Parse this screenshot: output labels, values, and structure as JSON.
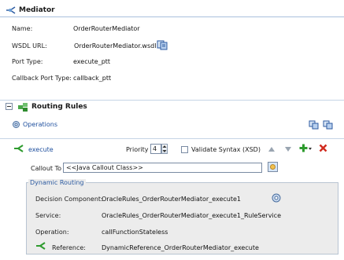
{
  "header": {
    "title": "Mediator"
  },
  "properties": [
    {
      "label": "Name:",
      "value": "OrderRouterMediator"
    },
    {
      "label": "WSDL URL:",
      "value": "OrderRouterMediator.wsdl"
    },
    {
      "label": "Port Type:",
      "value": "execute_ptt"
    },
    {
      "label": "Callback Port Type:",
      "value": "callback_ptt"
    }
  ],
  "routing": {
    "section_title": "Routing Rules",
    "operations_label": "Operations",
    "operation_name": "execute",
    "priority_label": "Priority",
    "priority_value": "4",
    "validate_label": "Validate Syntax (XSD)",
    "callout_label": "Callout To",
    "callout_value": "<<Java Callout Class>>"
  },
  "dynamic_routing": {
    "legend": "Dynamic Routing",
    "rows": [
      {
        "label": "Decision Component:",
        "value": "OracleRules_OrderRouterMediator_execute1"
      },
      {
        "label": "Service:",
        "value": "OracleRules_OrderRouterMediator_execute1_RuleService"
      },
      {
        "label": "Operation:",
        "value": "callFunctionStateless"
      },
      {
        "label": "Reference:",
        "value": "DynamicReference_OrderRouterMediator_execute"
      }
    ]
  },
  "colors": {
    "accent": "#2c5aa0",
    "panel_bg": "#ececec",
    "add": "#2e9b2e",
    "delete": "#d12b1f"
  }
}
